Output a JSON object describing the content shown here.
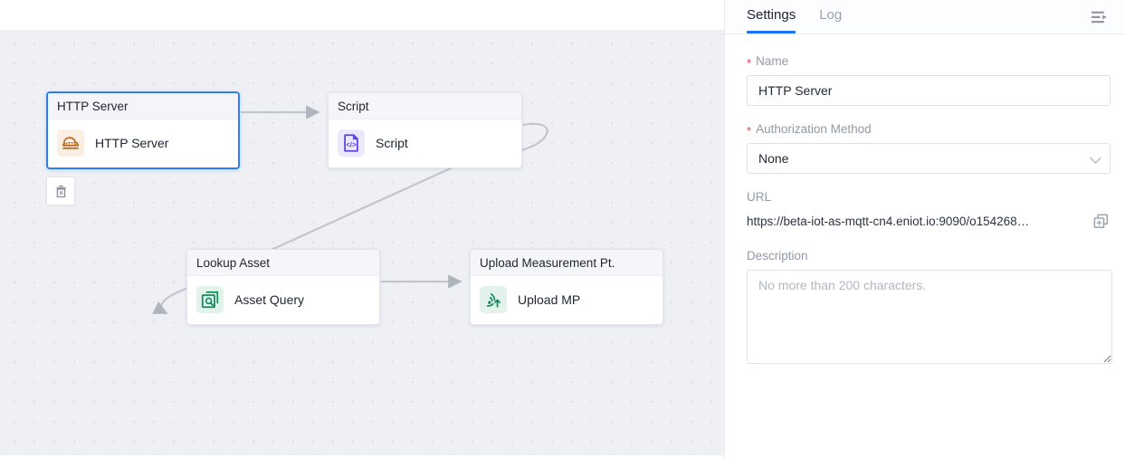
{
  "canvas": {
    "nodes": [
      {
        "id": "http-server",
        "header": "HTTP Server",
        "label": "HTTP Server",
        "icon": "http-cloud-icon",
        "selected": true
      },
      {
        "id": "script",
        "header": "Script",
        "label": "Script",
        "icon": "code-file-icon",
        "selected": false
      },
      {
        "id": "lookup-asset",
        "header": "Lookup Asset",
        "label": "Asset Query",
        "icon": "asset-query-icon",
        "selected": false
      },
      {
        "id": "upload-mp",
        "header": "Upload Measurement Pt.",
        "label": "Upload MP",
        "icon": "upload-signal-icon",
        "selected": false
      }
    ],
    "delete_button": {
      "icon": "trash-icon",
      "title": "Delete"
    },
    "edge_color": "#b9bdc7",
    "grid_color": "#dcdfe6",
    "background": "#eef0f4"
  },
  "panel": {
    "tabs": [
      {
        "id": "settings",
        "label": "Settings",
        "active": true
      },
      {
        "id": "log",
        "label": "Log",
        "active": false
      }
    ],
    "collapse_icon": "panel-collapse-icon",
    "accent_color": "#1a73f0",
    "fields": {
      "name": {
        "label": "Name",
        "required": true,
        "value": "HTTP Server",
        "placeholder": ""
      },
      "authorization_method": {
        "label": "Authorization Method",
        "required": true,
        "value": "None",
        "chevron_icon": "chevron-down-icon"
      },
      "url": {
        "label": "URL",
        "required": false,
        "value": "https://beta-iot-as-mqtt-cn4.eniot.io:9090/o154268…",
        "copy_icon": "copy-icon"
      },
      "description": {
        "label": "Description",
        "required": false,
        "value": "",
        "placeholder": "No more than 200 characters."
      }
    }
  }
}
